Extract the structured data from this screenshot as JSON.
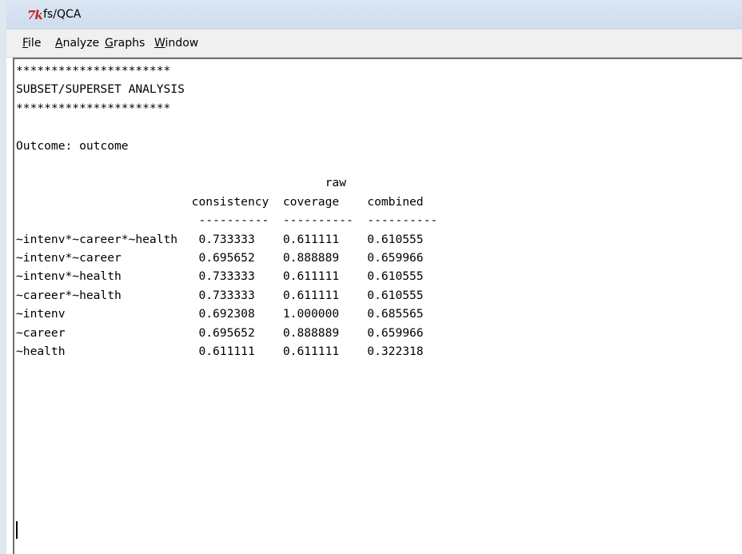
{
  "window": {
    "title": "fs/QCA",
    "logo": "7k"
  },
  "menu": {
    "file_underline": "F",
    "file_rest": "ile",
    "analyze_underline": "A",
    "analyze_rest": "nalyze",
    "graphs_underline": "G",
    "graphs_rest": "raphs",
    "window_underline": "W",
    "window_rest": "indow"
  },
  "output": {
    "lines": [
      "**********************",
      "SUBSET/SUPERSET ANALYSIS",
      "**********************",
      "",
      "Outcome: outcome",
      "",
      "                                            raw",
      "                         consistency  coverage    combined",
      "                          ----------  ----------  ----------",
      "~intenv*~career*~health   0.733333    0.611111    0.610555",
      "~intenv*~career           0.695652    0.888889    0.659966",
      "~intenv*~health           0.733333    0.611111    0.610555",
      "~career*~health           0.733333    0.611111    0.610555",
      "~intenv                   0.692308    1.000000    0.685565",
      "~career                   0.695652    0.888889    0.659966",
      "~health                   0.611111    0.611111    0.322318"
    ]
  }
}
